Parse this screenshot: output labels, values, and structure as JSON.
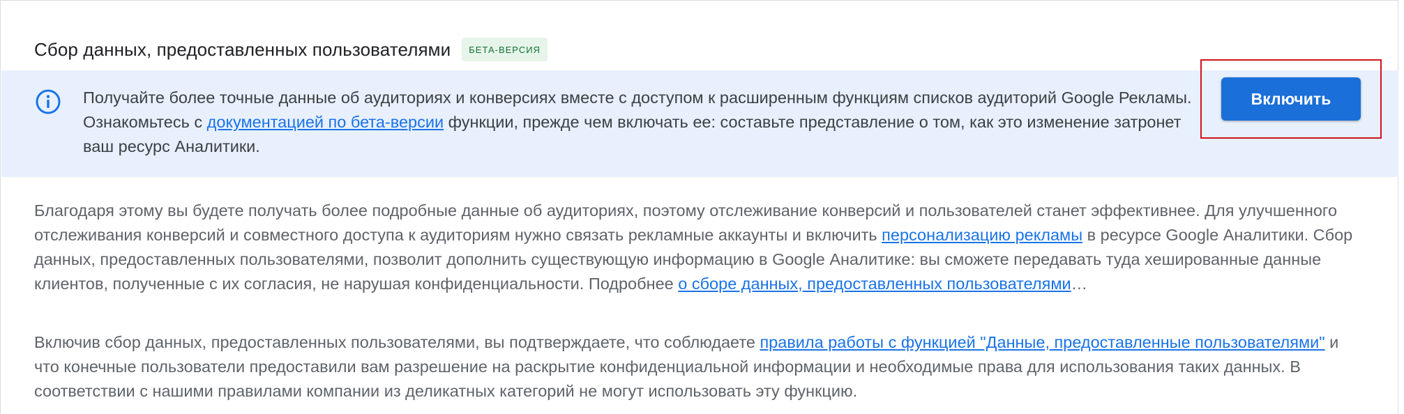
{
  "section": {
    "title": "Сбор данных, предоставленных пользователями",
    "badge": "БЕТА-ВЕРСИЯ"
  },
  "banner": {
    "icon": "info-icon",
    "text_before_link": "Получайте более точные данные об аудиториях и конверсиях вместе с доступом к расширенным функциям списков аудиторий Google Рекламы. Ознакомьтесь с ",
    "link_text": "документацией по бета-версии",
    "text_after_link": " функции, прежде чем включать ее: составьте представление о том, как это изменение затронет ваш ресурс Аналитики.",
    "button_label": "Включить"
  },
  "description": {
    "para1_before_link": "Благодаря этому вы будете получать более подробные данные об аудиториях, поэтому отслеживание конверсий и пользователей станет эффективнее. Для улучшенного отслеживания конверсий и совместного доступа к аудиториям нужно связать рекламные аккаунты и включить ",
    "para1_link1": "персонализацию рекламы",
    "para1_middle": " в ресурсе Google Аналитики. Сбор данных, предоставленных пользователями, позволит дополнить существующую информацию в Google Аналитике: вы сможете передавать туда хешированные данные клиентов, полученные с их согласия, не нарушая конфиденциальности. Подробнее ",
    "para1_link2": "о сборе данных, предоставленных пользователями",
    "para1_end": "…",
    "para2_before_link": "Включив сбор данных, предоставленных пользователями, вы подтверждаете, что соблюдаете ",
    "para2_link": "правила работы с функцией \"Данные, предоставленные пользователями\"",
    "para2_after_link": " и что конечные пользователи предоставили вам разрешение на раскрытие конфиденциальной информации и необходимые права для использования таких данных. В соответствии с нашими правилами компании из деликатных категорий не могут использовать эту функцию."
  },
  "colors": {
    "accent": "#1a73e8",
    "button": "#1a6fd8",
    "banner_bg": "#e8f0fe",
    "badge_bg": "#e6f4ea",
    "badge_text": "#137333",
    "highlight": "#d0121b"
  }
}
